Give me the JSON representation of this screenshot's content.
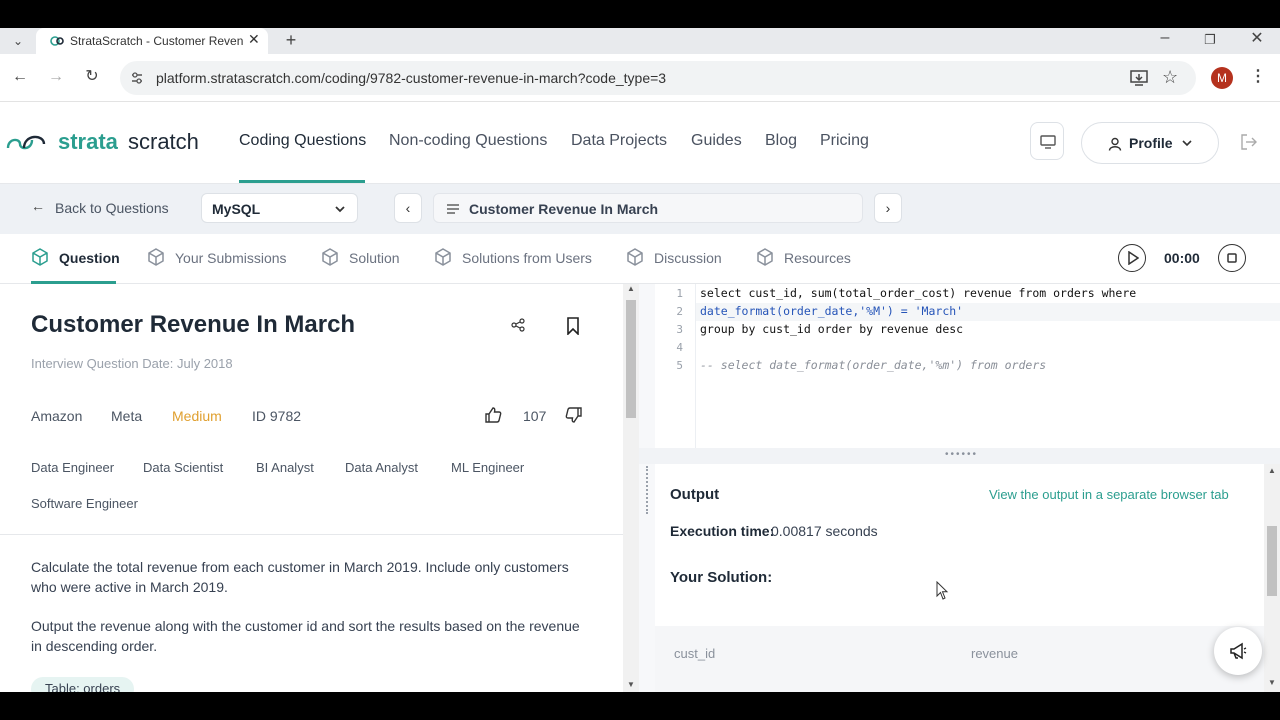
{
  "browser": {
    "tab_title": "StrataScratch - Customer Reven",
    "url": "platform.stratascratch.com/coding/9782-customer-revenue-in-march?code_type=3",
    "avatar_letter": "M"
  },
  "header": {
    "logo_strata": "strata",
    "logo_scratch": "scratch",
    "nav": [
      "Coding Questions",
      "Non-coding Questions",
      "Data Projects",
      "Guides",
      "Blog",
      "Pricing"
    ],
    "profile_label": "Profile"
  },
  "subheader": {
    "back_label": "Back to Questions",
    "language": "MySQL",
    "question_title": "Customer Revenue In March"
  },
  "tabs": [
    "Question",
    "Your Submissions",
    "Solution",
    "Solutions from Users",
    "Discussion",
    "Resources"
  ],
  "timer": "00:00",
  "question": {
    "title": "Customer Revenue In March",
    "interview_date": "Interview Question Date: July 2018",
    "companies": [
      "Amazon",
      "Meta"
    ],
    "difficulty": "Medium",
    "id_label": "ID 9782",
    "likes": "107",
    "roles": [
      "Data Engineer",
      "Data Scientist",
      "BI Analyst",
      "Data Analyst",
      "ML Engineer",
      "Software Engineer"
    ],
    "description_1": "Calculate the total revenue from each customer in March 2019. Include only customers who were active in March 2019.",
    "description_2": "Output the revenue along with the customer id and sort the results based on the revenue in descending order.",
    "table_label": "Table: orders"
  },
  "editor": {
    "line_numbers": [
      "1",
      "2",
      "3",
      "4",
      "5"
    ],
    "lines": [
      "select cust_id, sum(total_order_cost) revenue from orders where",
      "date_format(order_date,'%M') = 'March'",
      "group by cust_id order by revenue desc",
      "",
      "-- select date_format(order_date,'%m') from orders"
    ]
  },
  "output": {
    "title": "Output",
    "separate_link": "View the output in a separate browser tab",
    "exec_label": "Execution time:",
    "exec_value": "0.00817 seconds",
    "your_solution": "Your Solution:",
    "columns": [
      "cust_id",
      "revenue"
    ]
  },
  "colors": {
    "accent": "#2b9e8f",
    "difficulty": "#e0a030",
    "brand_dark": "#1f2a37"
  }
}
